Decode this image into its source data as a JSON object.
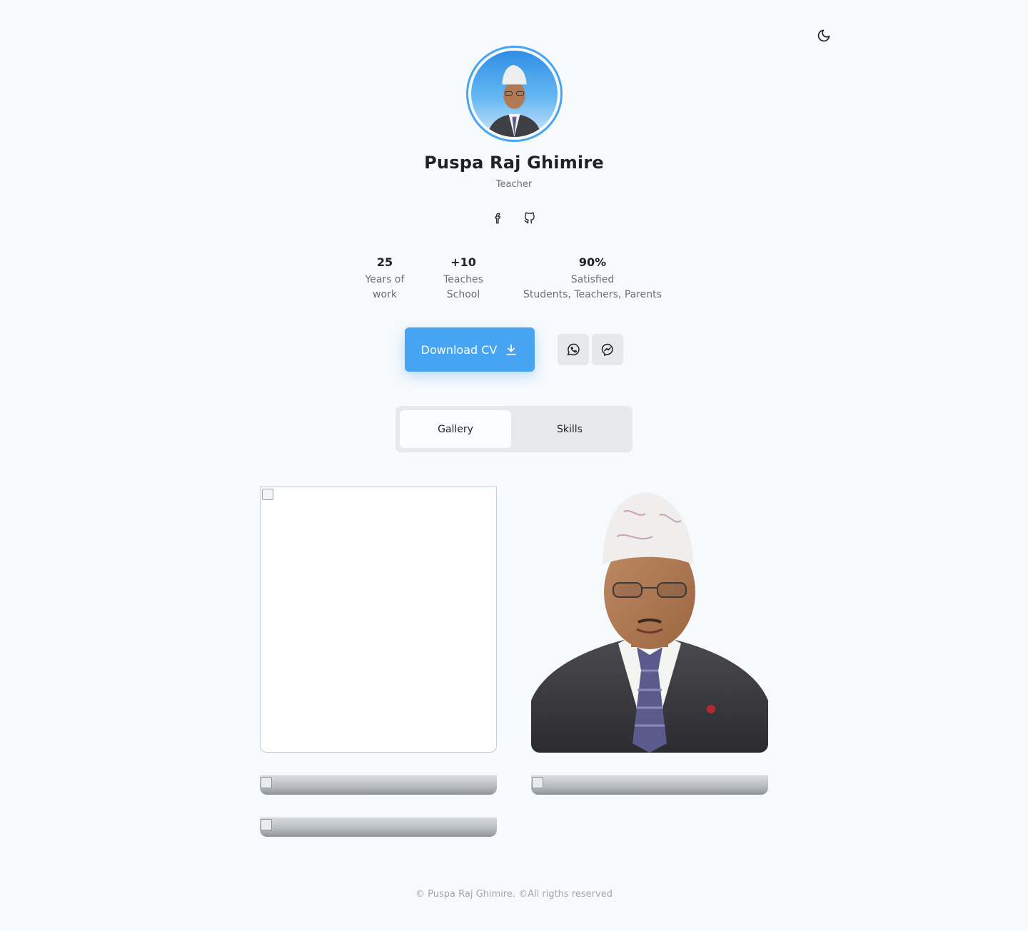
{
  "theme": {
    "toggle_icon": "moon-icon",
    "accent": "#47a4f2"
  },
  "profile": {
    "name": "Puspa Raj Ghimire",
    "role": "Teacher",
    "socials": [
      {
        "icon": "facebook-icon"
      },
      {
        "icon": "github-icon"
      }
    ]
  },
  "stats": [
    {
      "value": "25",
      "label_line1": "Years of",
      "label_line2": "work"
    },
    {
      "value": "+10",
      "label_line1": "Teaches",
      "label_line2": "School"
    },
    {
      "value": "90%",
      "label_line1": "Satisfied",
      "label_line2": "Students, Teachers, Parents"
    }
  ],
  "actions": {
    "download_label": "Download CV",
    "download_icon": "download-icon",
    "whatsapp_icon": "whatsapp-icon",
    "messenger_icon": "messenger-icon"
  },
  "tabs": [
    {
      "label": "Gallery",
      "active": true
    },
    {
      "label": "Skills",
      "active": false
    }
  ],
  "footer": {
    "text": "© Puspa Raj Ghimire. ©All rigths reserved"
  }
}
